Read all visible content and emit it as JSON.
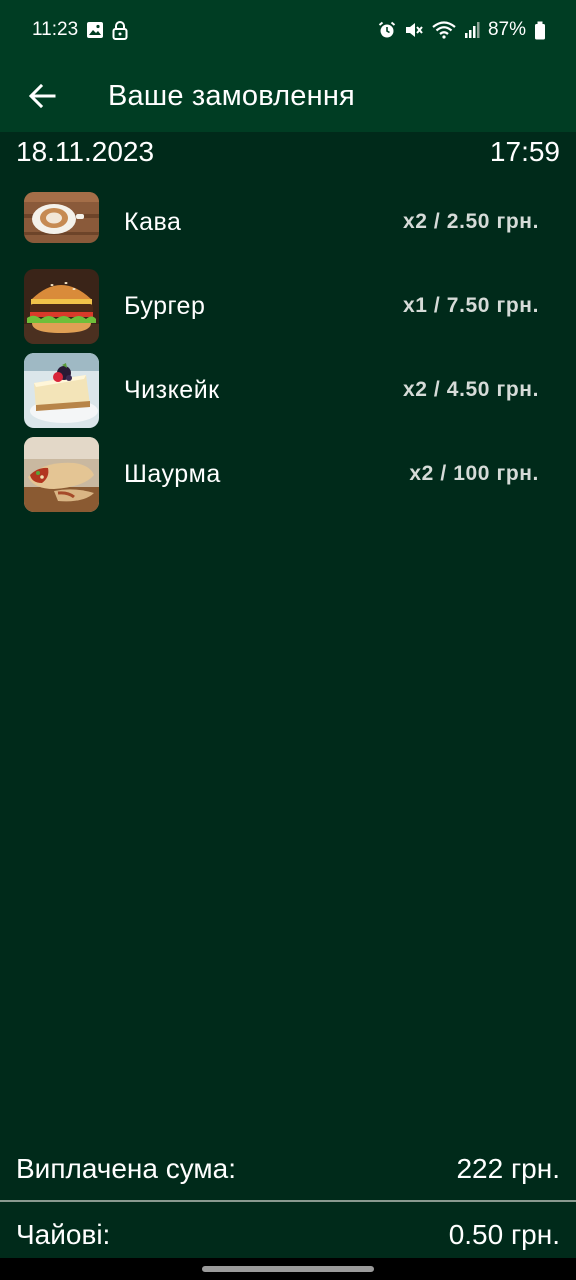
{
  "status_bar": {
    "time": "11:23",
    "battery": "87%",
    "icons": [
      "image-icon",
      "lock-icon",
      "alarm-icon",
      "mute-icon",
      "wifi-icon",
      "signal-icon",
      "battery-icon"
    ]
  },
  "app_bar": {
    "title": "Ваше замовлення",
    "back_icon": "arrow-left-icon"
  },
  "order": {
    "date": "18.11.2023",
    "time": "17:59",
    "items": [
      {
        "name": "Кава",
        "price": "x2 / 2.50 грн.",
        "image": "coffee-image"
      },
      {
        "name": "Бургер",
        "price": "x1 / 7.50 грн.",
        "image": "burger-image"
      },
      {
        "name": "Чизкейк",
        "price": "x2 / 4.50 грн.",
        "image": "cheesecake-image"
      },
      {
        "name": "Шаурма",
        "price": "x2 / 100 грн.",
        "image": "shawarma-image"
      }
    ]
  },
  "summary": {
    "paid_label": "Виплачена сума:",
    "paid_value": "222 грн.",
    "tips_label": "Чайові:",
    "tips_value": "0.50 грн."
  },
  "colors": {
    "background": "#002a1a",
    "app_bar": "#003d23",
    "text": "#ffffff",
    "price_text": "#d6dbd8"
  }
}
